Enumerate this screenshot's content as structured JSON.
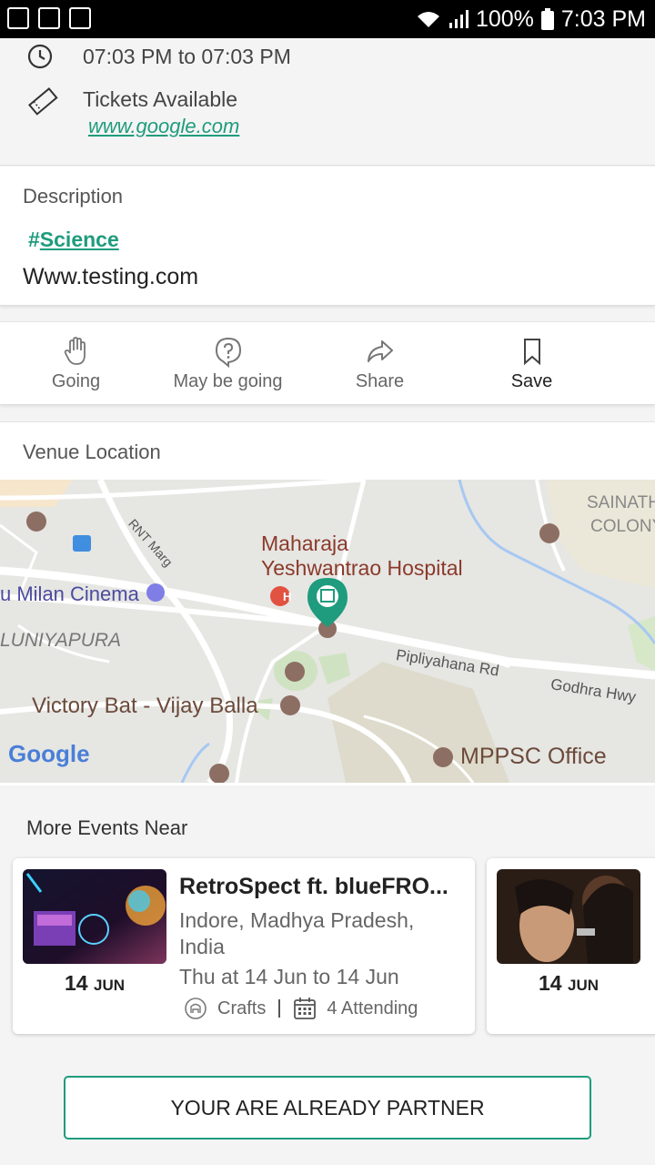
{
  "status_bar": {
    "battery": "100%",
    "time": "7:03 PM"
  },
  "event": {
    "time_range": "07:03 PM to 07:03 PM",
    "tickets_label": "Tickets Available",
    "ticket_link": "www.google.com"
  },
  "description": {
    "label": "Description",
    "hash": "#",
    "tag": "Science",
    "text": "Www.testing.com"
  },
  "actions": [
    {
      "label": "Going",
      "icon": "hand-icon"
    },
    {
      "label": "May be going",
      "icon": "question-bubble-icon"
    },
    {
      "label": "Share",
      "icon": "share-arrow-icon"
    },
    {
      "label": "Save",
      "icon": "bookmark-icon"
    }
  ],
  "venue": {
    "label": "Venue Location",
    "map_labels": {
      "hospital_line1": "Maharaja",
      "hospital_line2": "Yeshwantrao Hospital",
      "cinema": "u Milan Cinema",
      "area1": "LUNIYAPURA",
      "bat": "Victory Bat - Vijay Balla",
      "road1": "Pipliyahana Rd",
      "road2": "Godhra Hwy",
      "road3": "RNT Marg",
      "colony1": "SAINATH",
      "colony2": "COLONY",
      "office": "MPPSC Office",
      "google": "Google"
    }
  },
  "more_events": {
    "title": "More Events Near",
    "items": [
      {
        "title": "RetroSpect ft. blueFRO...",
        "location": "Indore, Madhya Pradesh, India",
        "when": "Thu at 14 Jun to 14 Jun",
        "category": "Crafts",
        "attending": "4 Attending",
        "day": "14",
        "month": "JUN"
      },
      {
        "day": "14",
        "month": "JUN"
      }
    ]
  },
  "partner_button": "YOUR ARE ALREADY PARTNER",
  "colors": {
    "accent": "#1e9c7d",
    "map_bg": "#e6e6e3",
    "hospital_text": "#8b3a2a"
  }
}
